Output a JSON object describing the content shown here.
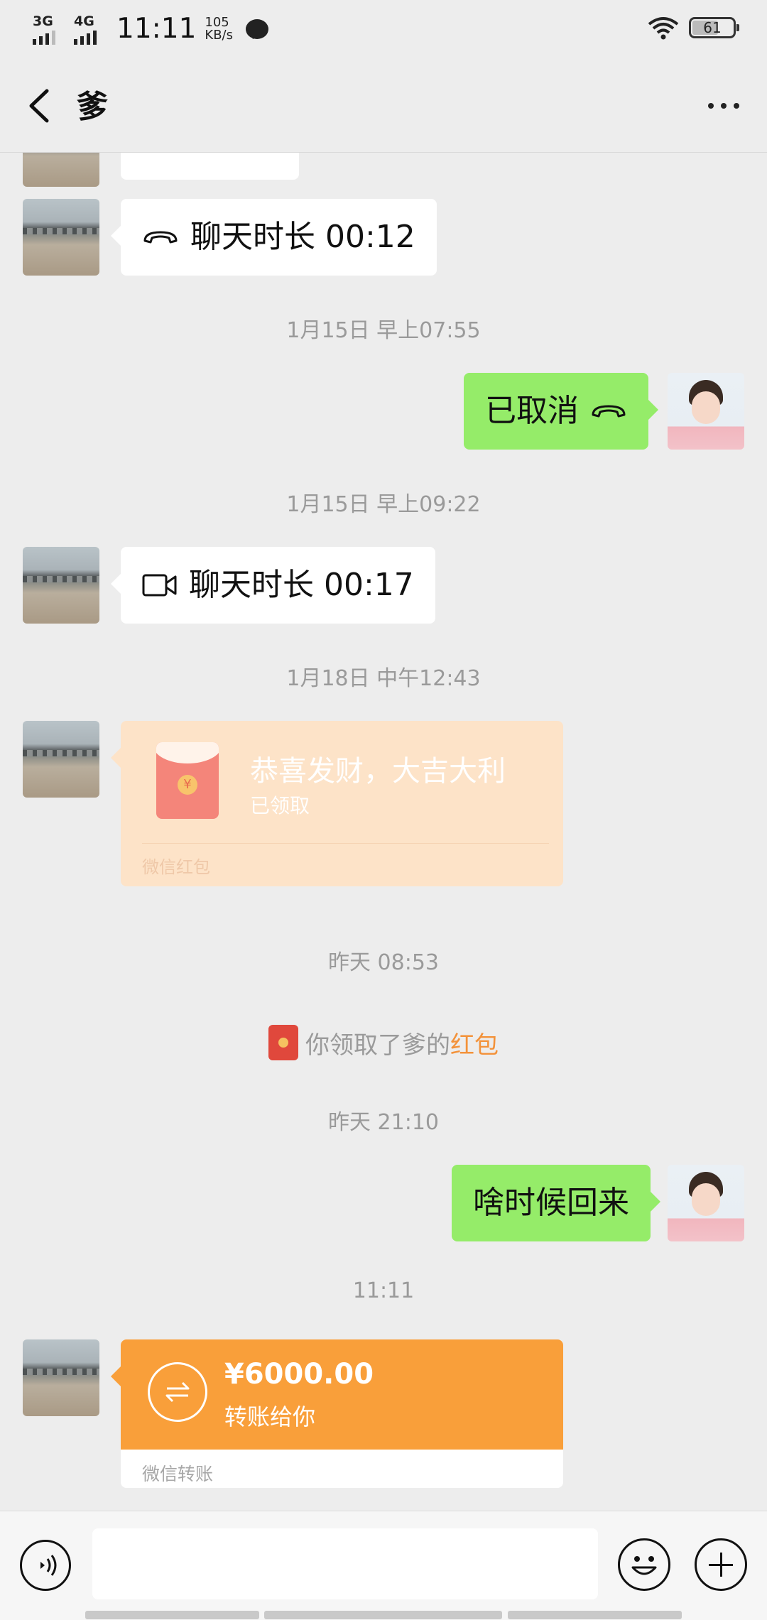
{
  "status_bar": {
    "net1": "3G",
    "net2": "4G",
    "time": "11:11",
    "speed_value": "105",
    "speed_unit": "KB/s",
    "battery": "61"
  },
  "header": {
    "title": "爹"
  },
  "messages": {
    "call1_text": "聊天时长 00:12",
    "ts1": "1月15日 早上07:55",
    "cancelled_text": "已取消",
    "ts2": "1月15日 早上09:22",
    "video_text": "聊天时长 00:17",
    "ts3": "1月18日 中午12:43",
    "redpacket": {
      "title": "恭喜发财，大吉大利",
      "status": "已领取",
      "footer": "微信红包"
    },
    "ts4": "昨天 08:53",
    "system": {
      "prefix": "你领取了爹的",
      "link": "红包"
    },
    "ts5": "昨天 21:10",
    "question": "啥时候回来",
    "ts6": "11:11",
    "transfer": {
      "amount": "¥6000.00",
      "desc": "转账给你",
      "footer": "微信转账"
    }
  },
  "colors": {
    "bubble_green": "#95ec69",
    "transfer_orange": "#f99f3a",
    "redpacket_bg": "#fde3c8"
  }
}
